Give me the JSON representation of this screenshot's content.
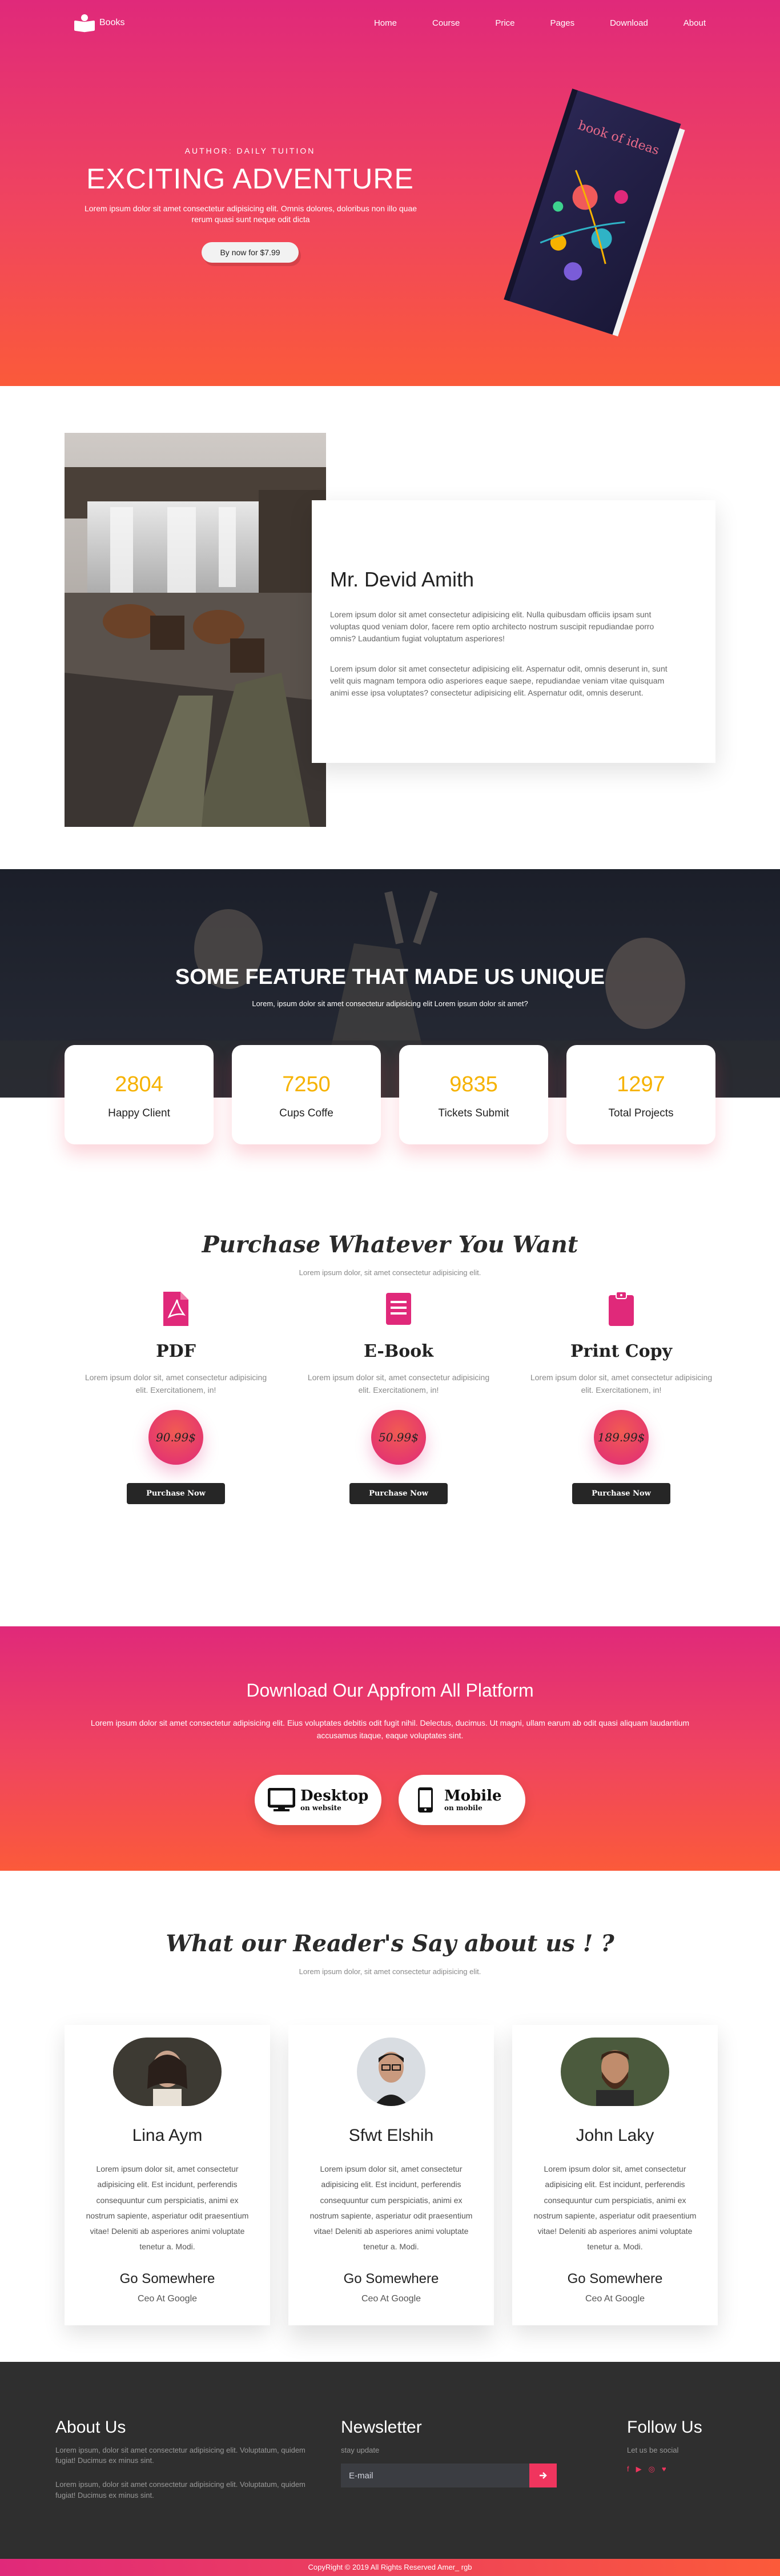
{
  "nav": {
    "logo": "Books",
    "links": [
      "Home",
      "Course",
      "Price",
      "Pages",
      "Download",
      "About"
    ]
  },
  "hero": {
    "eyebrow": "AUTHOR: DAILY TUITION",
    "title": "EXCITING ADVENTURE",
    "description": "Lorem ipsum dolor sit amet consectetur adipisicing elit. Omnis dolores, doloribus non illo quae rerum quasi sunt neque odit dicta",
    "button": "By now for $7.99",
    "book_cover_text": "book of ideas"
  },
  "profile": {
    "name": "Mr. Devid Amith",
    "p1": "Lorem ipsum dolor sit amet consectetur adipisicing elit. Nulla quibusdam officiis ipsam sunt voluptas quod veniam dolor, facere rem optio architecto nostrum suscipit repudiandae porro omnis? Laudantium fugiat voluptatum asperiores!",
    "p2": "Lorem ipsum dolor sit amet consectetur adipisicing elit. Aspernatur odit, omnis deserunt in, sunt velit quis magnam tempora odio asperiores eaque saepe, repudiandae veniam vitae quisquam animi esse ipsa voluptates? consectetur adipisicing elit. Aspernatur odit, omnis deserunt."
  },
  "features": {
    "title": "SOME FEATURE THAT MADE US UNIQUE",
    "subtitle": "Lorem, ipsum dolor sit amet consectetur adipisicing elit Lorem ipsum dolor sit amet?",
    "stats": [
      {
        "number": "2804",
        "label": "Happy Client"
      },
      {
        "number": "7250",
        "label": "Cups Coffe"
      },
      {
        "number": "9835",
        "label": "Tickets Submit"
      },
      {
        "number": "1297",
        "label": "Total Projects"
      }
    ]
  },
  "purchase": {
    "title": "Purchase Whatever You Want",
    "subtitle": "Lorem ipsum dolor, sit amet consectetur adipisicing elit.",
    "plans": [
      {
        "icon": "pdf-file-icon",
        "title": "PDF",
        "desc": "Lorem ipsum dolor sit, amet consectetur adipisicing elit. Exercitationem, in!",
        "price": "90.99$",
        "button": "Purchase Now"
      },
      {
        "icon": "ebook-icon",
        "title": "E-Book",
        "desc": "Lorem ipsum dolor sit, amet consectetur adipisicing elit. Exercitationem, in!",
        "price": "50.99$",
        "button": "Purchase Now"
      },
      {
        "icon": "clipboard-icon",
        "title": "Print Copy",
        "desc": "Lorem ipsum dolor sit, amet consectetur adipisicing elit. Exercitationem, in!",
        "price": "189.99$",
        "button": "Purchase Now"
      }
    ]
  },
  "download": {
    "title": "Download Our Appfrom All Platform",
    "description": "Lorem ipsum dolor sit amet consectetur adipisicing elit. Eius voluptates debitis odit fugit nihil. Delectus, ducimus. Ut magni, ullam earum ab odit quasi aliquam laudantium accusamus itaque, eaque voluptates sint.",
    "desktop": {
      "main": "Desktop",
      "sub": "on website"
    },
    "mobile": {
      "main": "Mobile",
      "sub": "on mobile"
    }
  },
  "testimonials": {
    "title": "What our Reader's Say about us ! ?",
    "subtitle": "Lorem ipsum dolor, sit amet consectetur adipisicing elit.",
    "items": [
      {
        "name": "Lina Aym",
        "text": "Lorem ipsum dolor sit, amet consectetur adipisicing elit. Est incidunt, perferendis consequuntur cum perspiciatis, animi ex nostrum sapiente, asperiatur odit praesentium vitae! Deleniti ab asperiores animi voluptate tenetur a. Modi.",
        "role": "Go Somewhere",
        "company": "Ceo At Google"
      },
      {
        "name": "Sfwt Elshih",
        "text": "Lorem ipsum dolor sit, amet consectetur adipisicing elit. Est incidunt, perferendis consequuntur cum perspiciatis, animi ex nostrum sapiente, asperiatur odit praesentium vitae! Deleniti ab asperiores animi voluptate tenetur a. Modi.",
        "role": "Go Somewhere",
        "company": "Ceo At Google"
      },
      {
        "name": "John Laky",
        "text": "Lorem ipsum dolor sit, amet consectetur adipisicing elit. Est incidunt, perferendis consequuntur cum perspiciatis, animi ex nostrum sapiente, asperiatur odit praesentium vitae! Deleniti ab asperiores animi voluptate tenetur a. Modi.",
        "role": "Go Somewhere",
        "company": "Ceo At Google"
      }
    ]
  },
  "footer": {
    "about_title": "About Us",
    "about_text1": "Lorem ipsum, dolor sit amet consectetur adipisicing elit. Voluptatum, quidem fugiat! Ducimus ex minus sint.",
    "about_text2": "Lorem ipsum, dolor sit amet consectetur adipisicing elit. Voluptatum, quidem fugiat! Ducimus ex minus sint.",
    "news_title": "Newsletter",
    "news_text": "stay update",
    "news_placeholder": "E-mail",
    "follow_title": "Follow Us",
    "follow_text": "Let us be social",
    "social": [
      "f",
      "▶",
      "◎",
      "♥"
    ],
    "copyright": "CopyRight © 2019 All Rights Reserved Amer_ rgb"
  },
  "colors": {
    "gradient_top": "#e0297a",
    "gradient_bottom": "#fb5a3a",
    "stat_number": "#f6b200",
    "accent": "#f0355e",
    "footer_bg": "#2f2f2f"
  }
}
